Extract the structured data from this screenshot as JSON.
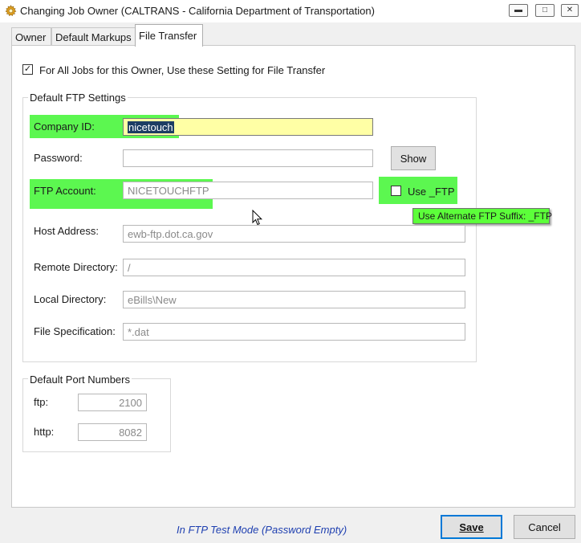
{
  "window": {
    "title": "Changing Job Owner  (CALTRANS - California Department of Transportation)",
    "icon": "gear-icon"
  },
  "tabs": [
    {
      "label": "Owner",
      "active": false
    },
    {
      "label": "Default Markups",
      "active": false
    },
    {
      "label": "File Transfer",
      "active": true
    }
  ],
  "file_transfer": {
    "use_for_all_jobs": {
      "label": "For All Jobs for this Owner, Use these Setting for File Transfer",
      "checked": true
    },
    "ftp_settings": {
      "group_label": "Default FTP Settings",
      "company_id": {
        "label": "Company ID:",
        "value": "nicetouch"
      },
      "password": {
        "label": "Password:",
        "value": ""
      },
      "show_button": "Show",
      "ftp_account": {
        "label": "FTP Account:",
        "value": "NICETOUCHFTP"
      },
      "use_ftp_suffix": {
        "label": "Use _FTP",
        "checked": false
      },
      "tooltip": "Use Alternate FTP Suffix: _FTP",
      "host_address": {
        "label": "Host Address:",
        "value": "ewb-ftp.dot.ca.gov"
      },
      "remote_directory": {
        "label": "Remote Directory:",
        "value": "/"
      },
      "local_directory": {
        "label": "Local Directory:",
        "value": "eBills\\New"
      },
      "file_specification": {
        "label": "File Specification:",
        "value": "*.dat"
      }
    },
    "port_numbers": {
      "group_label": "Default Port Numbers",
      "ftp": {
        "label": "ftp:",
        "value": "2100"
      },
      "http": {
        "label": "http:",
        "value": "8082"
      }
    }
  },
  "footer": {
    "status": "In FTP Test Mode (Password Empty)",
    "save_label": "Save",
    "cancel_label": "Cancel"
  },
  "colors": {
    "highlight": "#38f52a",
    "tooltip_bg": "#5cff3a",
    "company_field_bg": "#ffffa5",
    "status_text": "#1e3fb0",
    "default_button_border": "#0078d7"
  }
}
